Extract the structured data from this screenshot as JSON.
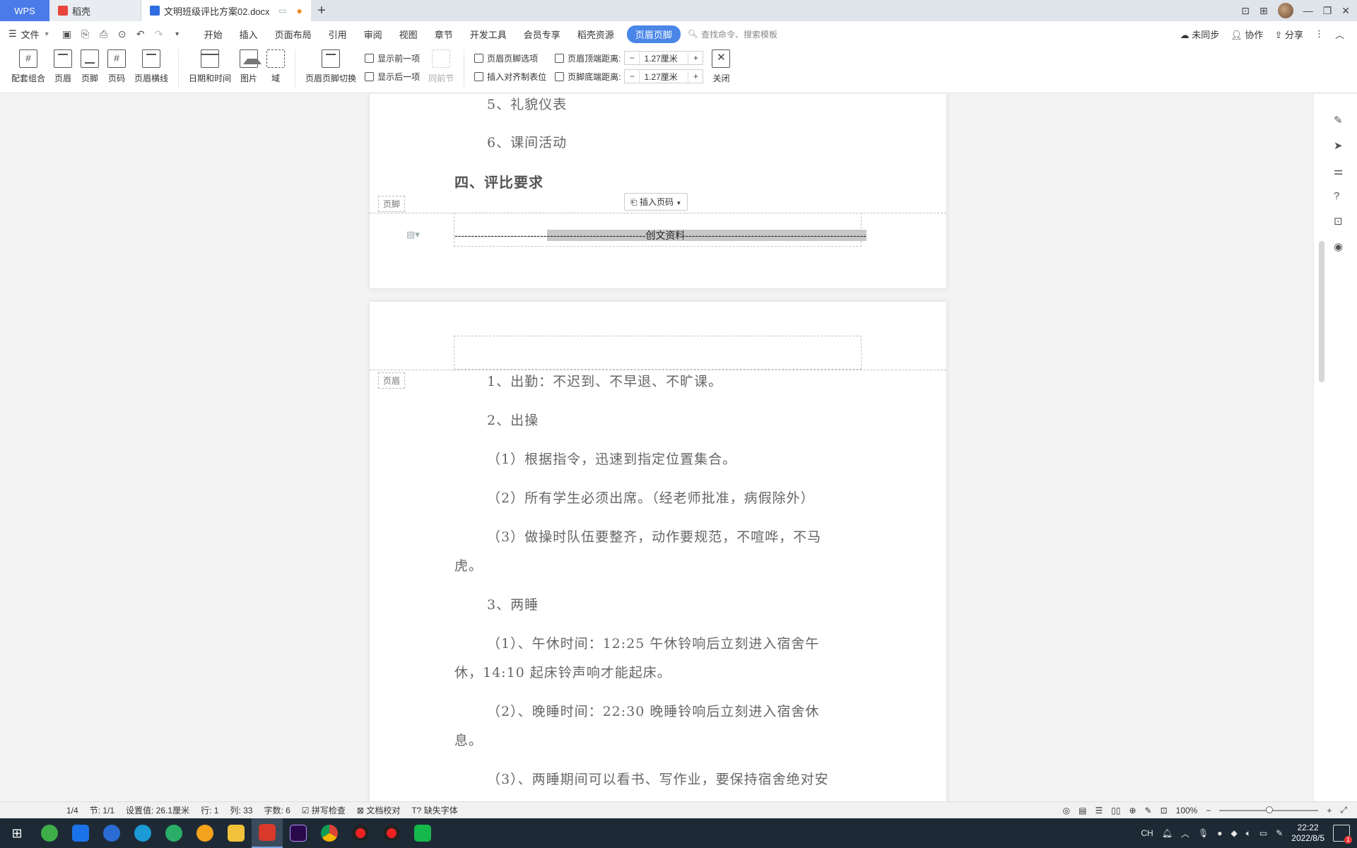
{
  "titlebar": {
    "wps_label": "WPS",
    "tab_docer": "稻壳",
    "tab_doc": "文明班级评比方案02.docx"
  },
  "menubar": {
    "file": "文件",
    "items": [
      "开始",
      "插入",
      "页面布局",
      "引用",
      "审阅",
      "视图",
      "章节",
      "开发工具",
      "会员专享",
      "稻壳资源"
    ],
    "active_item": "页眉页脚",
    "search_placeholder": "查找命令、搜索模板",
    "sync": "未同步",
    "collab": "协作",
    "share": "分享"
  },
  "ribbon": {
    "combo": "配套组合",
    "header": "页眉",
    "footer": "页脚",
    "page_number": "页码",
    "header_line": "页眉横线",
    "datetime": "日期和时间",
    "picture": "图片",
    "field": "域",
    "switch": "页眉页脚切换",
    "show_prev": "显示前一项",
    "show_next": "显示后一项",
    "same_as_prev": "同前节",
    "hf_options": "页眉页脚选项",
    "insert_tab": "插入对齐制表位",
    "header_top": "页眉顶端距离:",
    "footer_bottom": "页脚底端距离:",
    "header_top_value": "1.27厘米",
    "footer_bottom_value": "1.27厘米",
    "close": "关闭"
  },
  "doc": {
    "p1_lines": [
      "5、礼貌仪表",
      "6、课间活动"
    ],
    "p1_heading": "四、评比要求",
    "footer_label": "页脚",
    "insert_page_number": "插入页码",
    "footer_text_dashes_left": "----------------------------",
    "footer_text_dashes_mid": "------------------------------",
    "footer_text_center": "创文资料",
    "footer_text_dashes_right": "-------------------------------------------------------",
    "header_label": "页眉",
    "p2_lines": [
      "1、出勤：不迟到、不早退、不旷课。",
      "2、出操",
      "（1）根据指令，迅速到指定位置集合。",
      "（2）所有学生必须出席。（经老师批准，病假除外）",
      "（3）做操时队伍要整齐，动作要规范，不喧哗，不马",
      "虎。",
      "3、两睡",
      "（1）、午休时间：12:25 午休铃响后立刻进入宿舍午",
      "休，14:10 起床铃声响才能起床。",
      "（2）、晚睡时间：22:30 晚睡铃响后立刻进入宿舍休",
      "息。",
      "（3）、两睡期间可以看书、写作业，要保持宿舍绝对安"
    ]
  },
  "status": {
    "page": "1/4",
    "section": "节: 1/1",
    "setting": "设置值: 26.1厘米",
    "row": "行: 1",
    "col": "列: 33",
    "words": "字数: 6",
    "spell": "拼写检查",
    "proof": "文档校对",
    "missing_font": "缺失字体",
    "zoom": "100%"
  },
  "taskbar": {
    "ime": "CH",
    "time": "22:22",
    "date": "2022/8/5"
  },
  "colors": {
    "accent": "#4a86e8",
    "wps_tab": "#4a7be8",
    "taskbar": "#1d2a36"
  }
}
